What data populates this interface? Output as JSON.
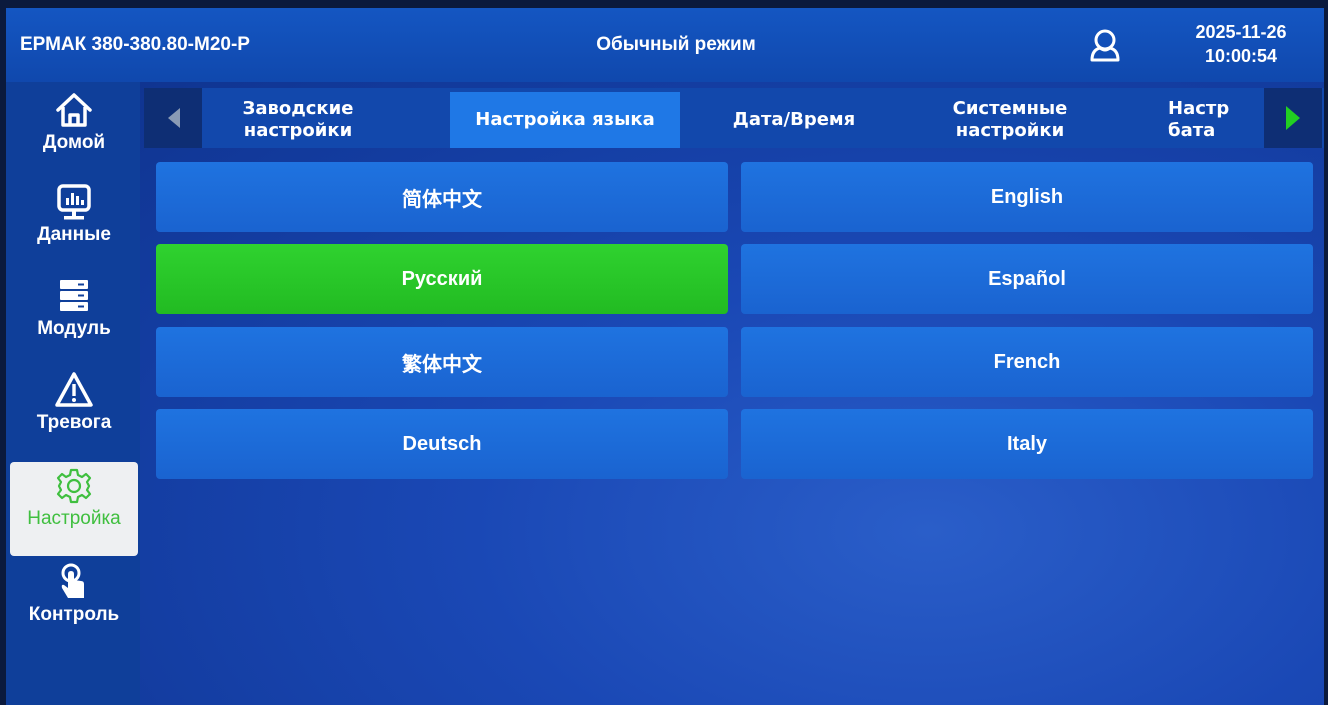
{
  "header": {
    "model": "ЕРМАК 380-380.80-М20-Р",
    "mode": "Обычный режим",
    "date": "2025-11-26",
    "time": "10:00:54"
  },
  "sidebar": {
    "items": [
      {
        "label": "Домой",
        "icon": "home-icon"
      },
      {
        "label": "Данные",
        "icon": "monitor-chart-icon"
      },
      {
        "label": "Модуль",
        "icon": "server-icon"
      },
      {
        "label": "Тревога",
        "icon": "warning-icon"
      },
      {
        "label": "Настройка",
        "icon": "gear-icon",
        "active": true
      },
      {
        "label": "Контроль",
        "icon": "touch-icon"
      }
    ]
  },
  "tabs": {
    "items": [
      {
        "label": "Заводские настройки"
      },
      {
        "label": "Настройка языка",
        "active": true
      },
      {
        "label": "Дата/Время"
      },
      {
        "label": "Системные настройки"
      },
      {
        "label": "Настр бата"
      }
    ]
  },
  "languages": {
    "items": [
      {
        "label": "简体中文"
      },
      {
        "label": "English"
      },
      {
        "label": "Русский",
        "selected": true
      },
      {
        "label": "Español"
      },
      {
        "label": "繁体中文"
      },
      {
        "label": "French"
      },
      {
        "label": "Deutsch"
      },
      {
        "label": "Italy"
      }
    ]
  },
  "colors": {
    "selected": "#2fd22f",
    "button": "#1f73e0",
    "active_tab": "#1f78e6",
    "active_nav_text": "#3fbf3f"
  }
}
